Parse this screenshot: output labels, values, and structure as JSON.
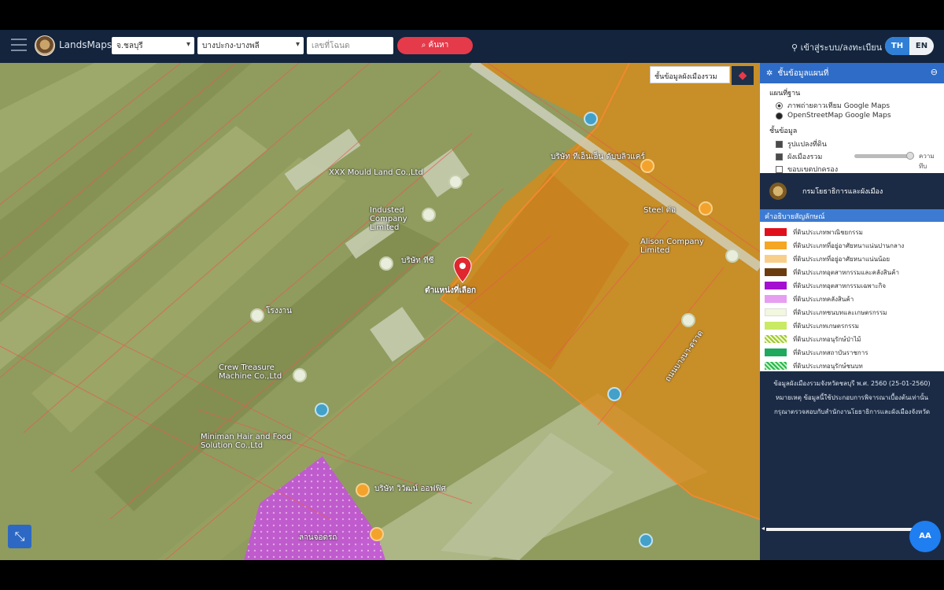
{
  "header": {
    "brand": "LandsMaps",
    "province_select": "จ.ชลบุรี",
    "district_select": "บางปะกง-บางพลี",
    "parcel_input_placeholder": "เลขที่โฉนด",
    "search_label": "ค้นหา",
    "account_label": "เข้าสู่ระบบ/ลงทะเบียน",
    "lang_th": "TH",
    "lang_en": "EN"
  },
  "map": {
    "layer_button_label": "ชั้นข้อมูลผังเมืองรวม",
    "pin_label": "ตำแหน่งที่เลือก",
    "place_labels": [
      "XXX Mould Land Co.,Ltd",
      "Industed Company Limited",
      "บริษัท ทีซี",
      "Crew Treasure Machine Co.,Ltd",
      "Alison Company Limited",
      "Steel ต่อ",
      "บริษัท ทีเอ็นเอ็น ดับบลิวแคร์",
      "โรงงาน",
      "Miniman Hair and Food Solution Co.,Ltd",
      "ลานจอดรถ",
      "บริษัท วิวัฒน์ ออฟฟิศ",
      "ถนนบางนา-ตราด"
    ]
  },
  "panel": {
    "title": "ชั้นข้อมูลแผนที่",
    "base_map_title": "แผนที่ฐาน",
    "base_options": [
      "ภาพถ่ายดาวเทียม Google Maps",
      "OpenStreetMap Google Maps"
    ],
    "overlay_title": "ชั้นข้อมูล",
    "overlay_options": [
      "รูปแปลงที่ดิน",
      "ผังเมืองรวม",
      "ขอบเขตปกครอง"
    ],
    "opacity_label": "ความทึบ",
    "agency_name": "กรมโยธาธิการและผังเมือง",
    "legend_title": "คำอธิบายสัญลักษณ์",
    "legend": [
      {
        "label": "ที่ดินประเภทพาณิชยกรรม",
        "color": "#e0101b"
      },
      {
        "label": "ที่ดินประเภทที่อยู่อาศัยหนาแน่นปานกลาง",
        "color": "#f5a623"
      },
      {
        "label": "ที่ดินประเภทที่อยู่อาศัยหนาแน่นน้อย",
        "color": "#f8cf8a"
      },
      {
        "label": "ที่ดินประเภทอุตสาหกรรมและคลังสินค้า",
        "color": "#6b3d0e"
      },
      {
        "label": "ที่ดินประเภทอุตสาหกรรมเฉพาะกิจ",
        "color": "#a40fd1"
      },
      {
        "label": "ที่ดินประเภทคลังสินค้า",
        "color": "#e69ef0"
      },
      {
        "label": "ที่ดินประเภทชนบทและเกษตรกรรม",
        "color": "#f2f7de"
      },
      {
        "label": "ที่ดินประเภทเกษตรกรรม",
        "color": "#c9ea63"
      },
      {
        "label": "ที่ดินประเภทอนุรักษ์ป่าไม้",
        "color": "hatch-g"
      },
      {
        "label": "ที่ดินประเภทสถาบันราชการ",
        "color": "#1fa95c"
      },
      {
        "label": "ที่ดินประเภทอนุรักษ์ชนบท",
        "color": "hatch-d"
      }
    ],
    "info_lines": [
      "ข้อมูลผังเมืองรวมจังหวัดชลบุรี พ.ศ. 2560 (25-01-2560)",
      "หมายเหตุ ข้อมูลนี้ใช้ประกอบการพิจารณาเบื้องต้นเท่านั้น",
      "กรุณาตรวจสอบกับสำนักงานโยธาธิการและผังเมืองจังหวัด"
    ],
    "fab_label": "AA"
  }
}
